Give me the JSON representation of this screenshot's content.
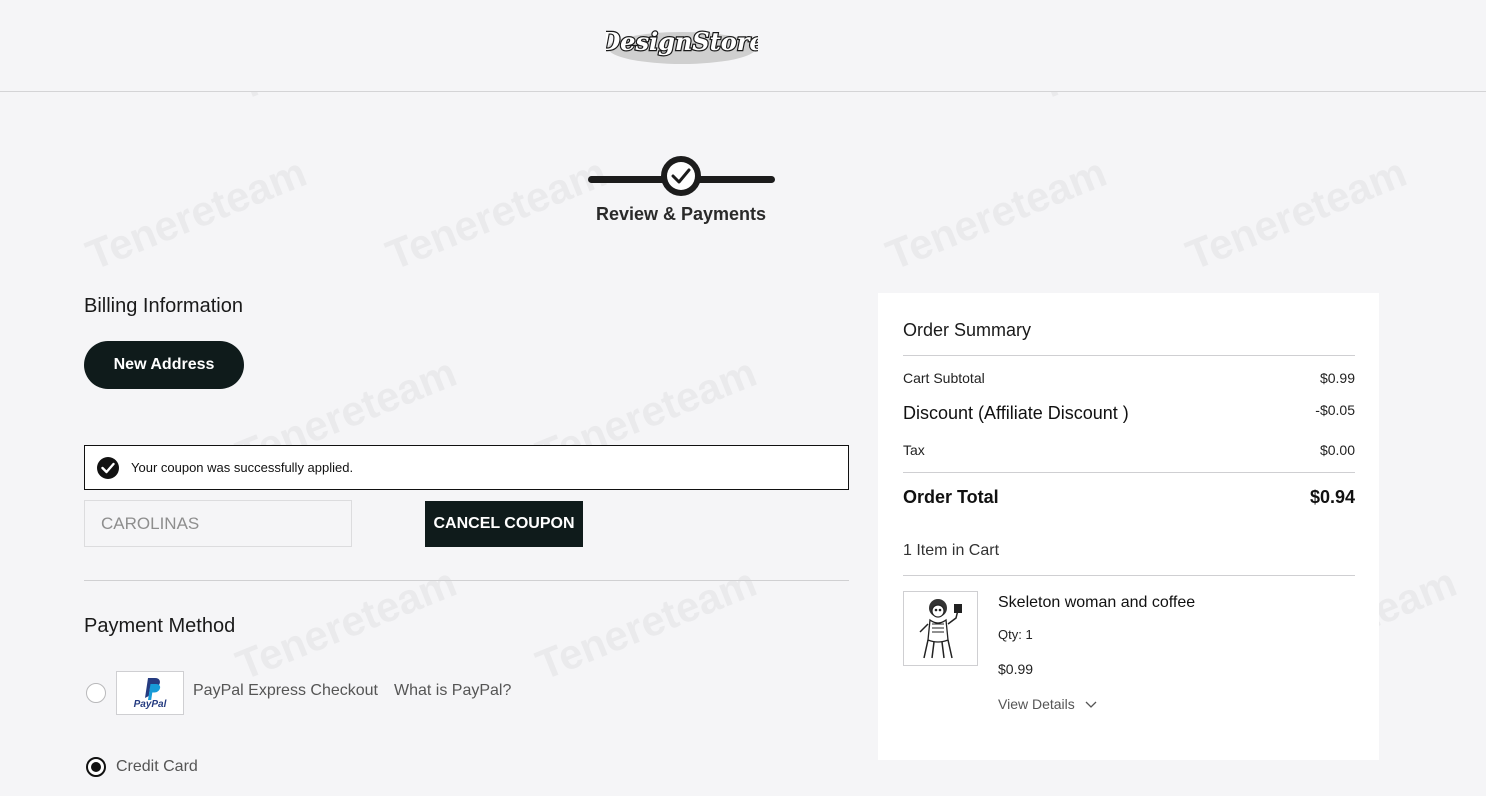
{
  "header": {
    "logo_text": "DesignStore"
  },
  "progress": {
    "step_label": "Review & Payments"
  },
  "billing": {
    "title": "Billing Information",
    "new_address_label": "New Address"
  },
  "coupon": {
    "success_message": "Your coupon was successfully applied.",
    "code_value": "CAROLINAS",
    "cancel_label": "CANCEL COUPON"
  },
  "payment": {
    "title": "Payment Method",
    "paypal_logo_text": "PayPal",
    "paypal_label": "PayPal Express Checkout",
    "paypal_link": "What is PayPal?",
    "credit_card_label": "Credit Card",
    "selected": "Credit Card"
  },
  "summary": {
    "title": "Order Summary",
    "subtotal_label": "Cart Subtotal",
    "subtotal_value": "$0.99",
    "discount_label": "Discount (Affiliate Discount )",
    "discount_value": "-$0.05",
    "tax_label": "Tax",
    "tax_value": "$0.00",
    "total_label": "Order Total",
    "total_value": "$0.94",
    "items_count": "1 Item in Cart",
    "product": {
      "name": "Skeleton woman and coffee",
      "qty": "Qty: 1",
      "price": "$0.99",
      "view_details": "View Details"
    }
  },
  "watermark": "Tenereteam",
  "colors": {
    "dark_button": "#0f1b1b",
    "background": "#f5f5f7",
    "paypal_blue": "#253b80"
  }
}
